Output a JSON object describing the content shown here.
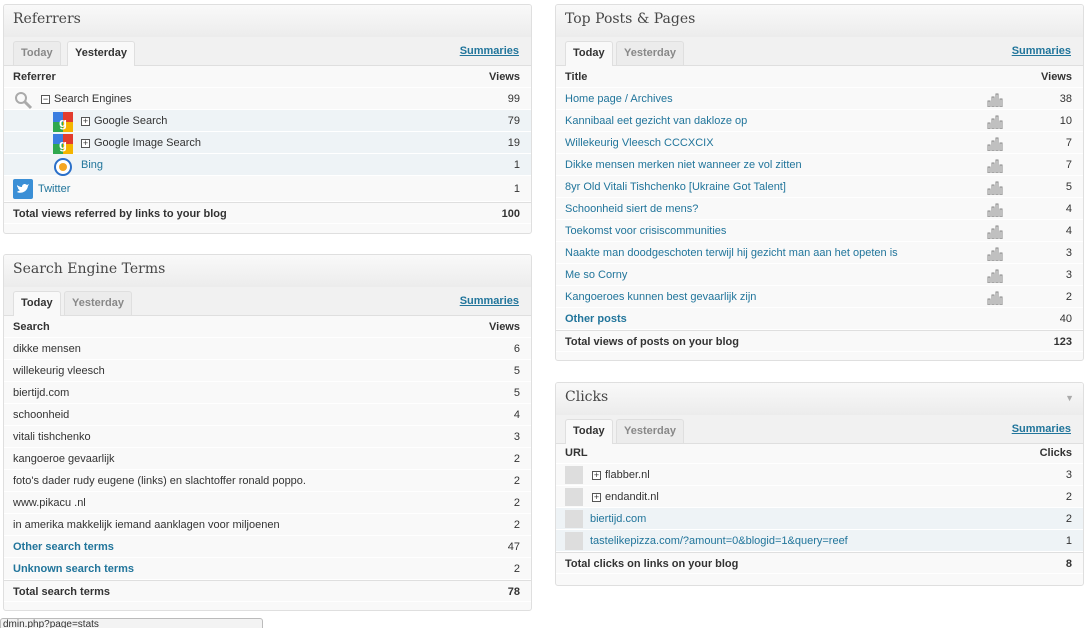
{
  "summaries_label": "Summaries",
  "referrers": {
    "title": "Referrers",
    "tabs": [
      "Today",
      "Yesterday"
    ],
    "active_tab": "Yesterday",
    "col_label": "Referrer",
    "col_views": "Views",
    "rows": [
      {
        "label": "Search Engines",
        "views": "99",
        "icon": "search-icon",
        "expander": true,
        "indent": 0
      },
      {
        "label": "Google Search",
        "views": "79",
        "icon": "google-icon",
        "expander": true,
        "indent": 1
      },
      {
        "label": "Google Image Search",
        "views": "19",
        "icon": "google-icon",
        "expander": true,
        "indent": 1
      },
      {
        "label": "Bing",
        "views": "1",
        "icon": "bing-icon",
        "expander": false,
        "indent": 1
      },
      {
        "label": "Twitter",
        "views": "1",
        "icon": "twitter-icon",
        "expander": false,
        "indent": 0
      }
    ],
    "total_label": "Total views referred by links to your blog",
    "total_value": "100"
  },
  "search_terms": {
    "title": "Search Engine Terms",
    "tabs": [
      "Today",
      "Yesterday"
    ],
    "active_tab": "Today",
    "col_label": "Search",
    "col_views": "Views",
    "rows": [
      {
        "label": "dikke mensen",
        "views": "6"
      },
      {
        "label": "willekeurig vleesch",
        "views": "5"
      },
      {
        "label": "biertijd.com",
        "views": "5"
      },
      {
        "label": "schoonheid",
        "views": "4"
      },
      {
        "label": "vitali tishchenko",
        "views": "3"
      },
      {
        "label": "kangoeroe gevaarlijk",
        "views": "2"
      },
      {
        "label": "foto's dader rudy eugene (links) en slachtoffer ronald poppo.",
        "views": "2"
      },
      {
        "label": "www.pikacu .nl",
        "views": "2"
      },
      {
        "label": "in amerika makkelijk iemand aanklagen voor miljoenen",
        "views": "2"
      }
    ],
    "other_label": "Other search terms",
    "other_value": "47",
    "unknown_label": "Unknown search terms",
    "unknown_value": "2",
    "total_label": "Total search terms",
    "total_value": "78"
  },
  "top_posts": {
    "title": "Top Posts & Pages",
    "tabs": [
      "Today",
      "Yesterday"
    ],
    "active_tab": "Today",
    "col_label": "Title",
    "col_views": "Views",
    "rows": [
      {
        "label": "Home page / Archives",
        "views": "38"
      },
      {
        "label": "Kannibaal eet gezicht van dakloze op",
        "views": "10"
      },
      {
        "label": "Willekeurig Vleesch CCCXCIX",
        "views": "7"
      },
      {
        "label": "Dikke mensen merken niet wanneer ze vol zitten",
        "views": "7"
      },
      {
        "label": "8yr Old Vitali Tishchenko [Ukraine Got Talent]",
        "views": "5"
      },
      {
        "label": "Schoonheid siert de mens?",
        "views": "4"
      },
      {
        "label": "Toekomst voor crisiscommunities",
        "views": "4"
      },
      {
        "label": "Naakte man doodgeschoten terwijl hij gezicht man aan het opeten is",
        "views": "3"
      },
      {
        "label": "Me so Corny",
        "views": "3"
      },
      {
        "label": "Kangoeroes kunnen best gevaarlijk zijn",
        "views": "2"
      }
    ],
    "other_label": "Other posts",
    "other_value": "40",
    "total_label": "Total views of posts on your blog",
    "total_value": "123"
  },
  "clicks": {
    "title": "Clicks",
    "tabs": [
      "Today",
      "Yesterday"
    ],
    "active_tab": "Today",
    "col_label": "URL",
    "col_views": "Clicks",
    "rows": [
      {
        "label": "flabber.nl",
        "views": "3",
        "expander": true
      },
      {
        "label": "endandit.nl",
        "views": "2",
        "expander": true
      },
      {
        "label": "biertijd.com",
        "views": "2",
        "expander": false
      },
      {
        "label": "tastelikepizza.com/?amount=0&blogid=1&query=reef",
        "views": "1",
        "expander": false
      }
    ],
    "total_label": "Total clicks on links on your blog",
    "total_value": "8"
  },
  "status_bar": {
    "text": "dmin.php?page=stats"
  }
}
